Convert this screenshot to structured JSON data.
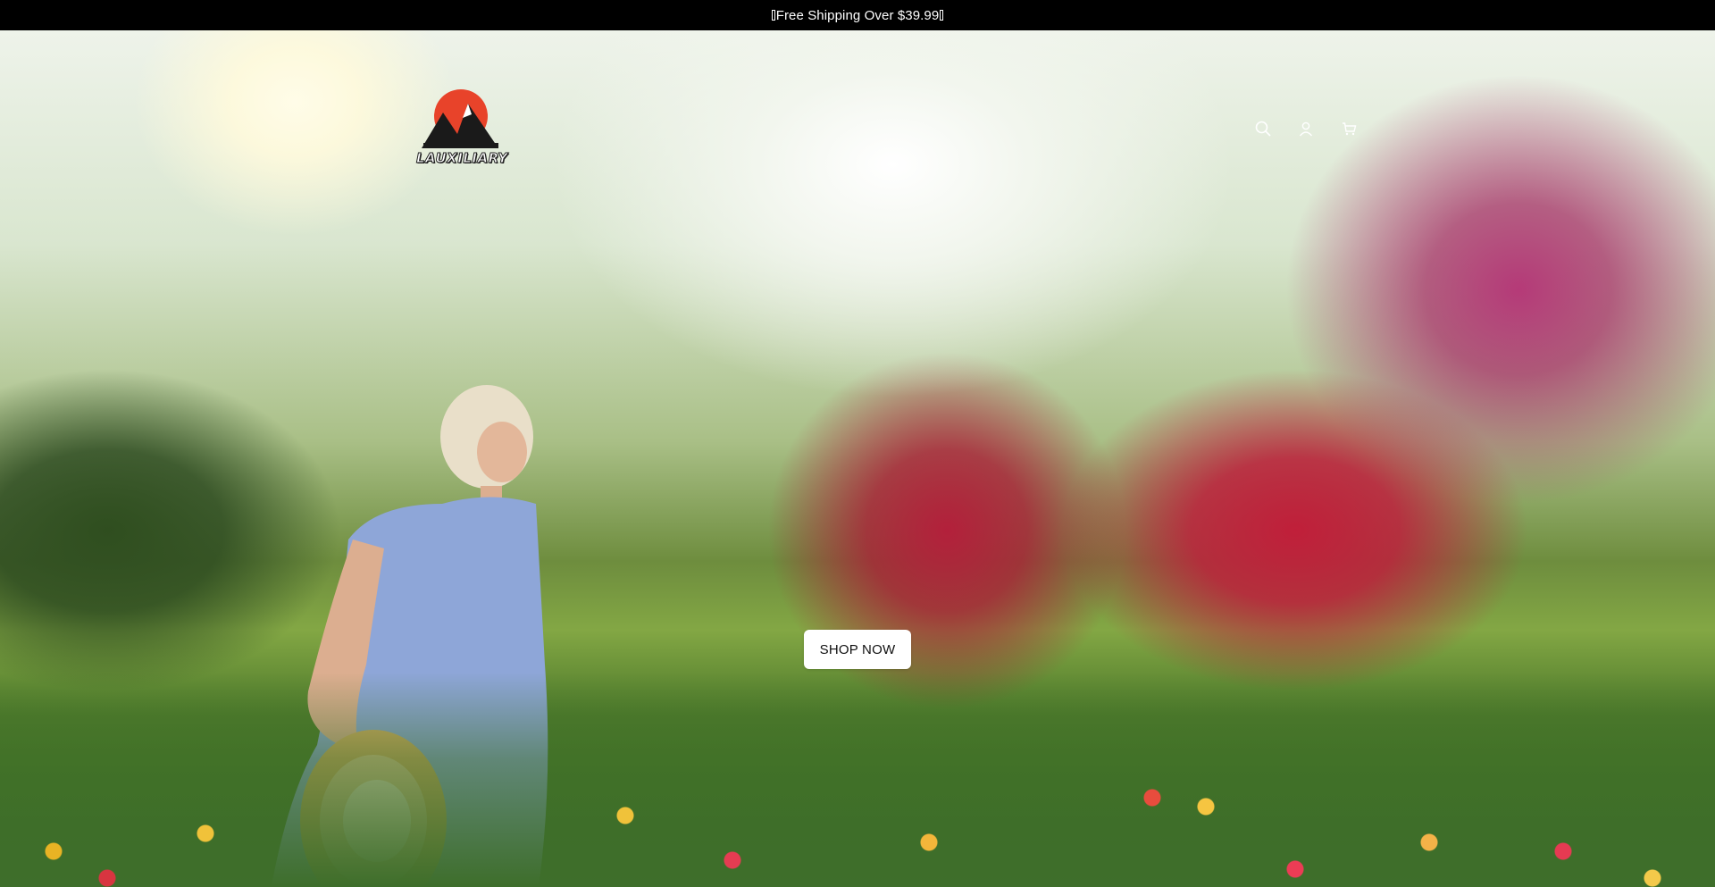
{
  "announcement": {
    "text": "Free Shipping Over $39.99",
    "glyph_before": "missing-glyph-box",
    "glyph_after": "missing-glyph-box"
  },
  "header": {
    "logo": {
      "text": "LAUXILIARY",
      "colors": {
        "sun": "#e8432a",
        "mountains": "#1a1a1a"
      }
    },
    "icons": [
      "search-icon",
      "account-icon",
      "cart-icon"
    ]
  },
  "hero": {
    "image": "woman-in-blue-dress-in-tulip-garden",
    "cta_label": "SHOP NOW"
  },
  "colors": {
    "announcement_bg": "#000000",
    "announcement_text": "#ffffff",
    "button_bg": "#ffffff",
    "button_text": "#111111"
  }
}
